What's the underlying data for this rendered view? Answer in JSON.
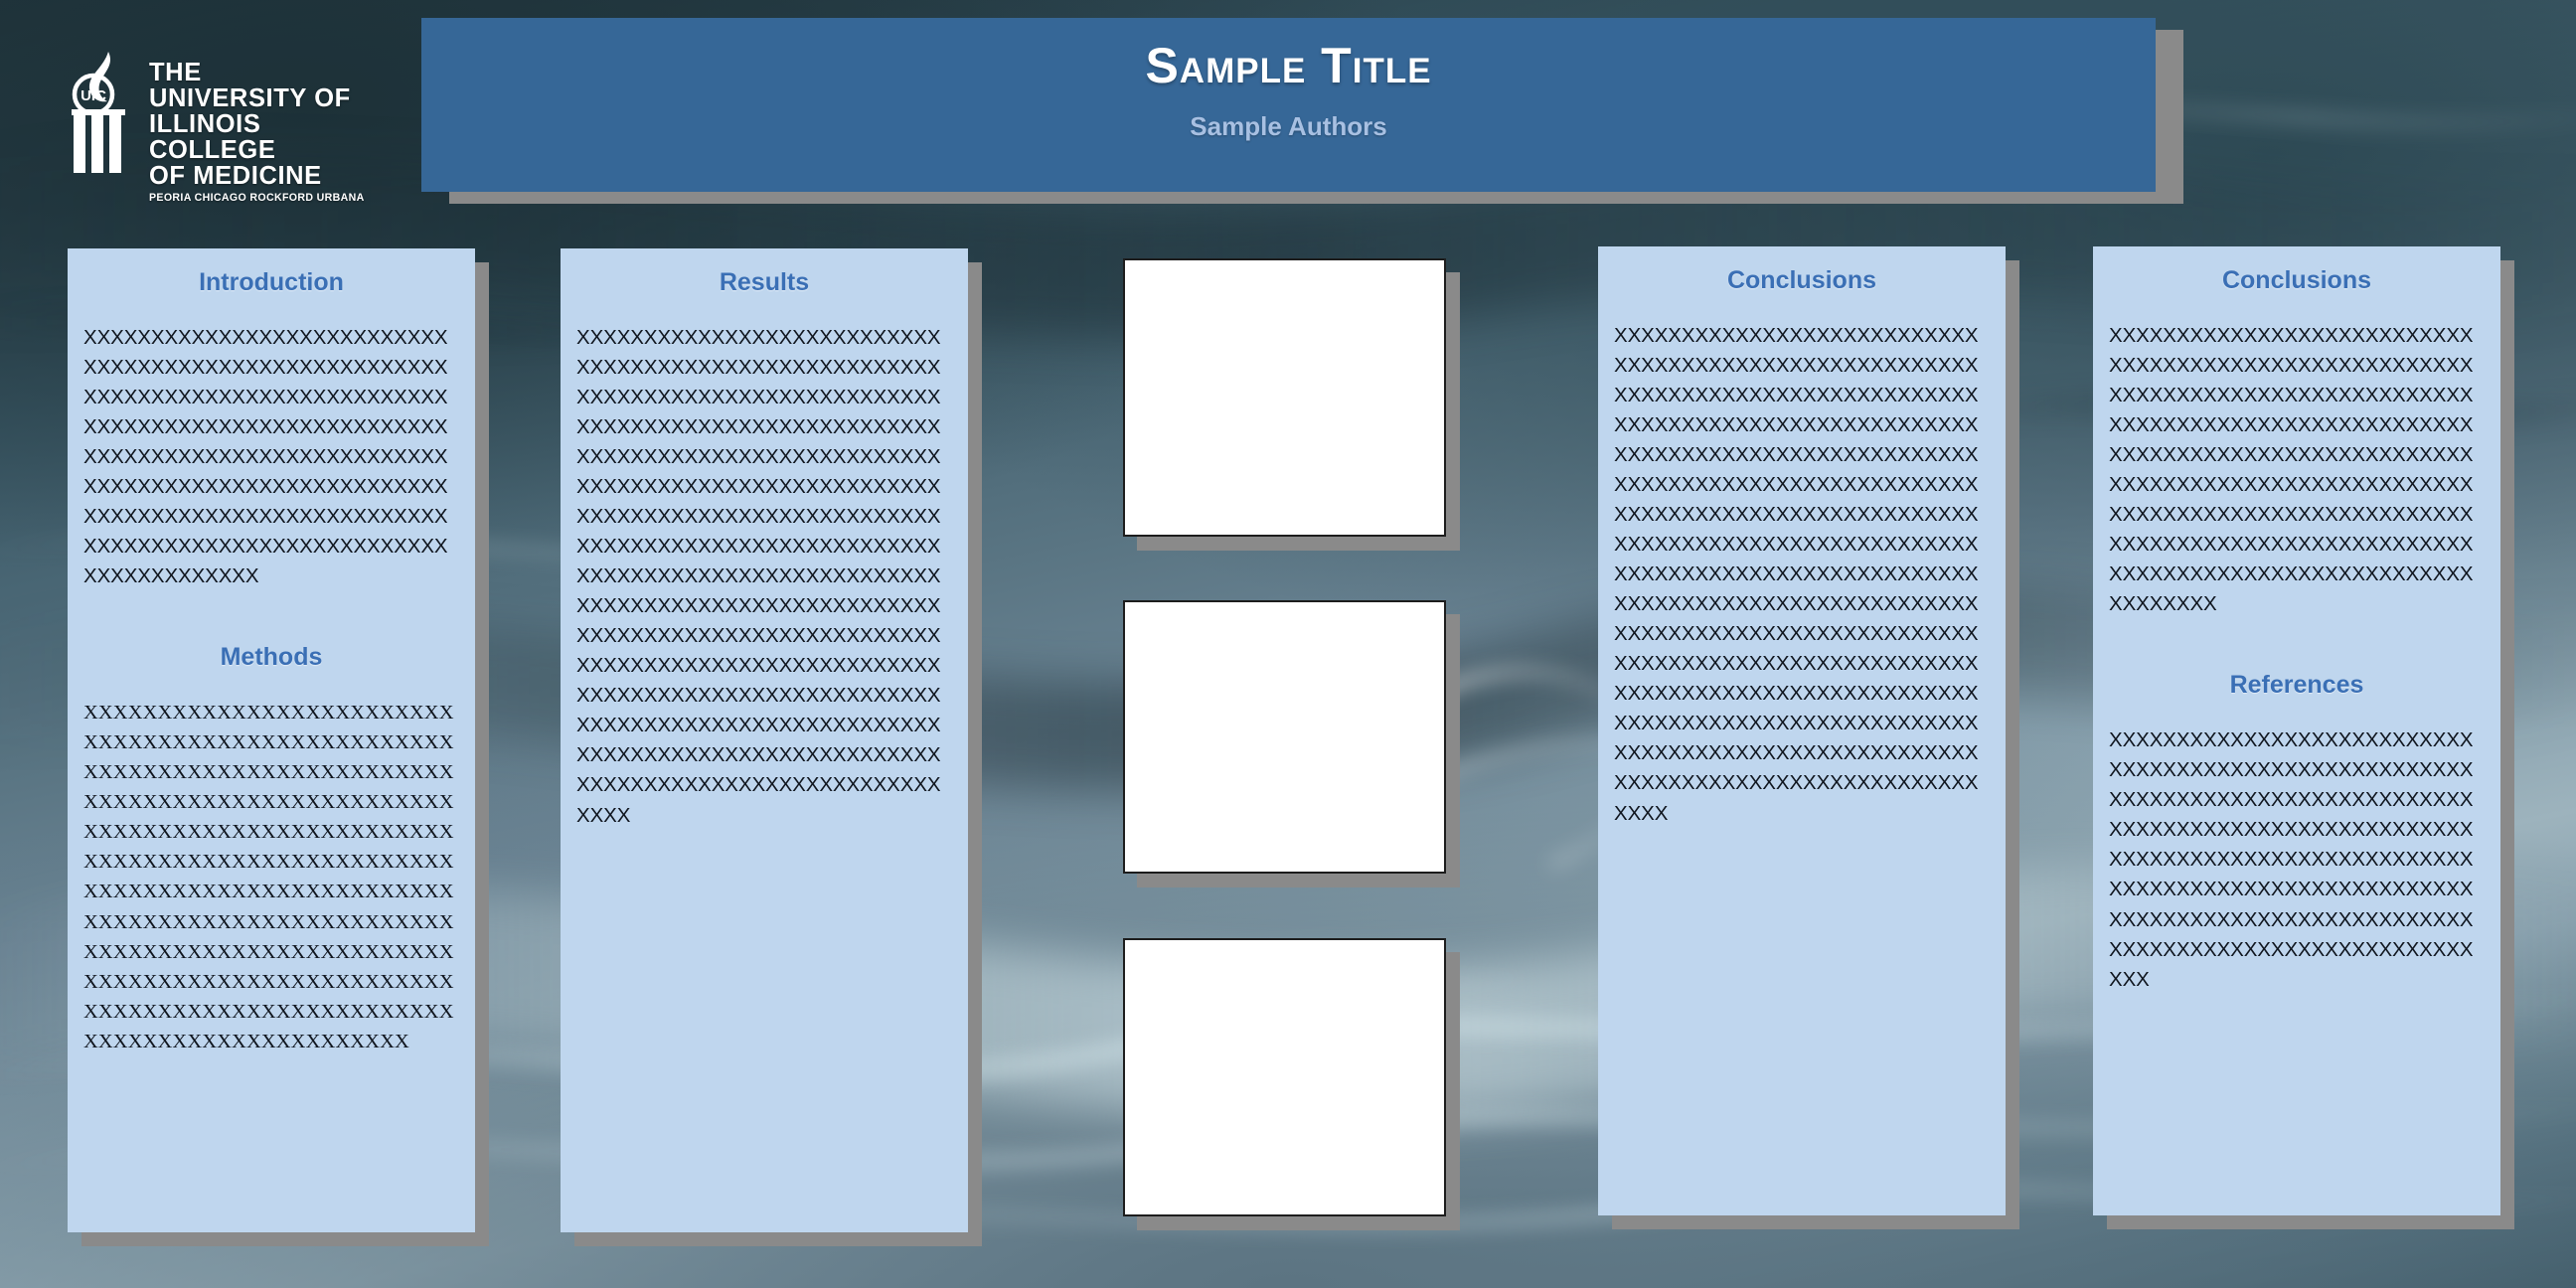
{
  "poster": {
    "background_color": "#2a3f48",
    "panel_color": "#bfd6ee",
    "banner_color": "#366797",
    "heading_color": "#3a6fb5",
    "shadow_color": "#8a8a8a"
  },
  "logo": {
    "mark_text": "UIC",
    "line1": "THE",
    "line2": "UNIVERSITY OF",
    "line3": "ILLINOIS",
    "line4": "COLLEGE",
    "line5": "OF MEDICINE",
    "campuses": "PEORIA  CHICAGO  ROCKFORD  URBANA"
  },
  "banner": {
    "title": "Sample Title",
    "authors": "Sample Authors"
  },
  "columns": [
    {
      "name": "column-1",
      "sections": [
        {
          "heading": "Introduction",
          "font": "sans",
          "body": "XXXXXXXXXXXXXXXXXXXXXXXXXXXXXXXXXXXXXXXXXXXXXXXXXXXXXXXXXXXXXXXXXXXXXXXXXXXXXXXXXXXXXXXXXXXXXXXXXXXXXXXXXXXXXXXXXXXXXXXXXXXXXXXXXXXXXXXXXXXXXXXXXXXXXXXXXXXXXXXXXXXXXXXXXXXXXXXXXXXXXXXXXXXXXXXXXXXXXXXXXXXXXXXXXXXXXXXXXXXXXXXXXXXXX"
        },
        {
          "heading": "Methods",
          "font": "serif",
          "body": "XXXXXXXXXXXXXXXXXXXXXXXXXXXXXXXXXXXXXXXXXXXXXXXXXXXXXXXXXXXXXXXXXXXXXXXXXXXXXXXXXXXXXXXXXXXXXXXXXXXXXXXXXXXXXXXXXXXXXXXXXXXXXXXXXXXXXXXXXXXXXXXXXXXXXXXXXXXXXXXXXXXXXXXXXXXXXXXXXXXXXXXXXXXXXXXXXXXXXXXXXXXXXXXXXXXXXXXXXXXXXXXXXXXXXXXXXXXXXXXXXXXXXXXXXXXXXXXXXXXXXXXXXXXXXXXXXXXXXXXXXXXXXXXXXXXXXXXXX"
        }
      ]
    },
    {
      "name": "column-2",
      "sections": [
        {
          "heading": "Results",
          "font": "sans",
          "body": "XXXXXXXXXXXXXXXXXXXXXXXXXXXXXXXXXXXXXXXXXXXXXXXXXXXXXXXXXXXXXXXXXXXXXXXXXXXXXXXXXXXXXXXXXXXXXXXXXXXXXXXXXXXXXXXXXXXXXXXXXXXXXXXXXXXXXXXXXXXXXXXXXXXXXXXXXXXXXXXXXXXXXXXXXXXXXXXXXXXXXXXXXXXXXXXXXXXXXXXXXXXXXXXXXXXXXXXXXXXXXXXXXXXXXXXXXXXXXXXXXXXXXXXXXXXXXXXXXXXXXXXXXXXXXXXXXXXXXXXXXXXXXXXXXXXXXXXXXXXXXXXXXXXXXXXXXXXXXXXXXXXXXXXXXXXXXXXXXXXXXXXXXXXXXXXXXXXXXXXXXXXXXXXXXXXXXXXXXXXXXXXXXXXXXXXXXXXXXXXXXXXXXXXXXXXXXXXXXXXXXXXXXXXXXXXXXXXX"
        }
      ]
    },
    {
      "name": "column-3",
      "sections": [
        {
          "heading": "Conclusions",
          "font": "sans",
          "body": "XXXXXXXXXXXXXXXXXXXXXXXXXXXXXXXXXXXXXXXXXXXXXXXXXXXXXXXXXXXXXXXXXXXXXXXXXXXXXXXXXXXXXXXXXXXXXXXXXXXXXXXXXXXXXXXXXXXXXXXXXXXXXXXXXXXXXXXXXXXXXXXXXXXXXXXXXXXXXXXXXXXXXXXXXXXXXXXXXXXXXXXXXXXXXXXXXXXXXXXXXXXXXXXXXXXXXXXXXXXXXXXXXXXXXXXXXXXXXXXXXXXXXXXXXXXXXXXXXXXXXXXXXXXXXXXXXXXXXXXXXXXXXXXXXXXXXXXXXXXXXXXXXXXXXXXXXXXXXXXXXXXXXXXXXXXXXXXXXXXXXXXXXXXXXXXXXXXXXXXXXXXXXXXXXXXXXXXXXXXXXXXXXXXXXXXXXXXXXXXXXXXXXXXXXXXXXXXXXXXXXXXXXXXXXXXXXXXX"
        }
      ]
    },
    {
      "name": "column-4",
      "sections": [
        {
          "heading": "Conclusions",
          "font": "sans",
          "body": "XXXXXXXXXXXXXXXXXXXXXXXXXXXXXXXXXXXXXXXXXXXXXXXXXXXXXXXXXXXXXXXXXXXXXXXXXXXXXXXXXXXXXXXXXXXXXXXXXXXXXXXXXXXXXXXXXXXXXXXXXXXXXXXXXXXXXXXXXXXXXXXXXXXXXXXXXXXXXXXXXXXXXXXXXXXXXXXXXXXXXXXXXXXXXXXXXXXXXXXXXXXXXXXXXXXXXXXXXXXXXXXXXXXXXXXXXXXXXXXXXXXXXXXXXXX"
        },
        {
          "heading": "References",
          "font": "sans",
          "body": "XXXXXXXXXXXXXXXXXXXXXXXXXXXXXXXXXXXXXXXXXXXXXXXXXXXXXXXXXXXXXXXXXXXXXXXXXXXXXXXXXXXXXXXXXXXXXXXXXXXXXXXXXXXXXXXXXXXXXXXXXXXXXXXXXXXXXXXXXXXXXXXXXXXXXXXXXXXXXXXXXXXXXXXXXXXXXXXXXXXXXXXXXXXXXXXXXXXXXXXXXXXXXXXXXXXXXXXXXXX"
        }
      ]
    }
  ],
  "image_placeholders": [
    {
      "name": "image-placeholder-1",
      "caption": ""
    },
    {
      "name": "image-placeholder-2",
      "caption": ""
    },
    {
      "name": "image-placeholder-3",
      "caption": ""
    }
  ]
}
